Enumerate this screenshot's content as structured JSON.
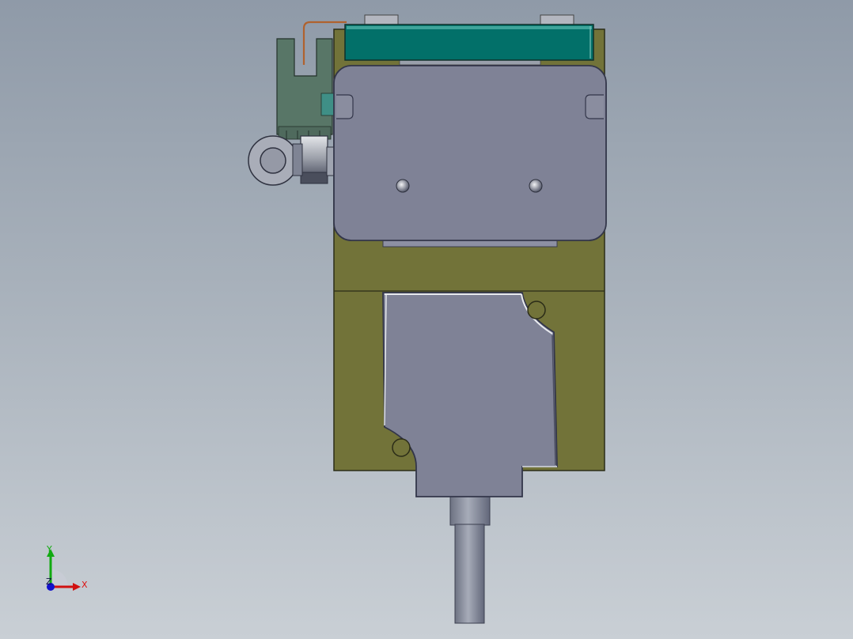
{
  "viewport": {
    "background_top": "#8f9aa8",
    "background_bottom": "#c9cfd5"
  },
  "model": {
    "body_color": "#727339",
    "plate_color": "#7f8296",
    "top_bar_color": "#027069",
    "bracket_color": "#587667",
    "wire_color": "#b0622e",
    "cylinder_color": "#868c9c"
  },
  "triad": {
    "x_label": "X",
    "y_label": "Y",
    "z_label": "Z",
    "x_color": "#d11111",
    "y_color": "#11aa11",
    "z_color": "#1111cc"
  }
}
